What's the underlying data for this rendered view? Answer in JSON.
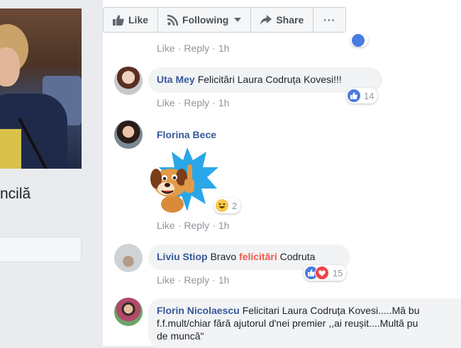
{
  "profile": {
    "name": "ncilă"
  },
  "toolbar": {
    "like_label": "Like",
    "following_label": "Following",
    "share_label": "Share",
    "more_label": "···"
  },
  "comments": [
    {
      "actions": {
        "like": "Like",
        "sep": "·",
        "reply": "Reply",
        "time": "1h"
      }
    },
    {
      "author": "Uta Mey",
      "text": "Felicitări Laura Codruța Kovesi!!!",
      "reaction_count": "14",
      "actions": {
        "like": "Like",
        "sep": "·",
        "reply": "Reply",
        "time": "1h"
      }
    },
    {
      "author": "Florina Bece",
      "sticker": "dog-thumbs-up-sticker",
      "reaction_count": "2",
      "actions": {
        "like": "Like",
        "sep": "·",
        "reply": "Reply",
        "time": "1h"
      }
    },
    {
      "author": "Liviu Stiop",
      "text_before": "Bravo ",
      "text_highlight": "felicitări",
      "text_after": " Codruta",
      "reaction_count": "15",
      "actions": {
        "like": "Like",
        "sep": "·",
        "reply": "Reply",
        "time": "1h"
      }
    },
    {
      "author": "Florin Nicolaescu",
      "text_line1": "Felicitari Laura Codruța Kovesi.....Mă bu",
      "text_line2": "f.f.mult/chiar fără ajutorul d'nei premier ,,ai reușit....Multă pu",
      "text_line3": "de muncă\""
    }
  ],
  "colors": {
    "author": "#385898",
    "highlight": "#f05a4a",
    "like_blue": "#4a7be0",
    "love_red": "#f0424d",
    "meta_gray": "#90949c"
  }
}
